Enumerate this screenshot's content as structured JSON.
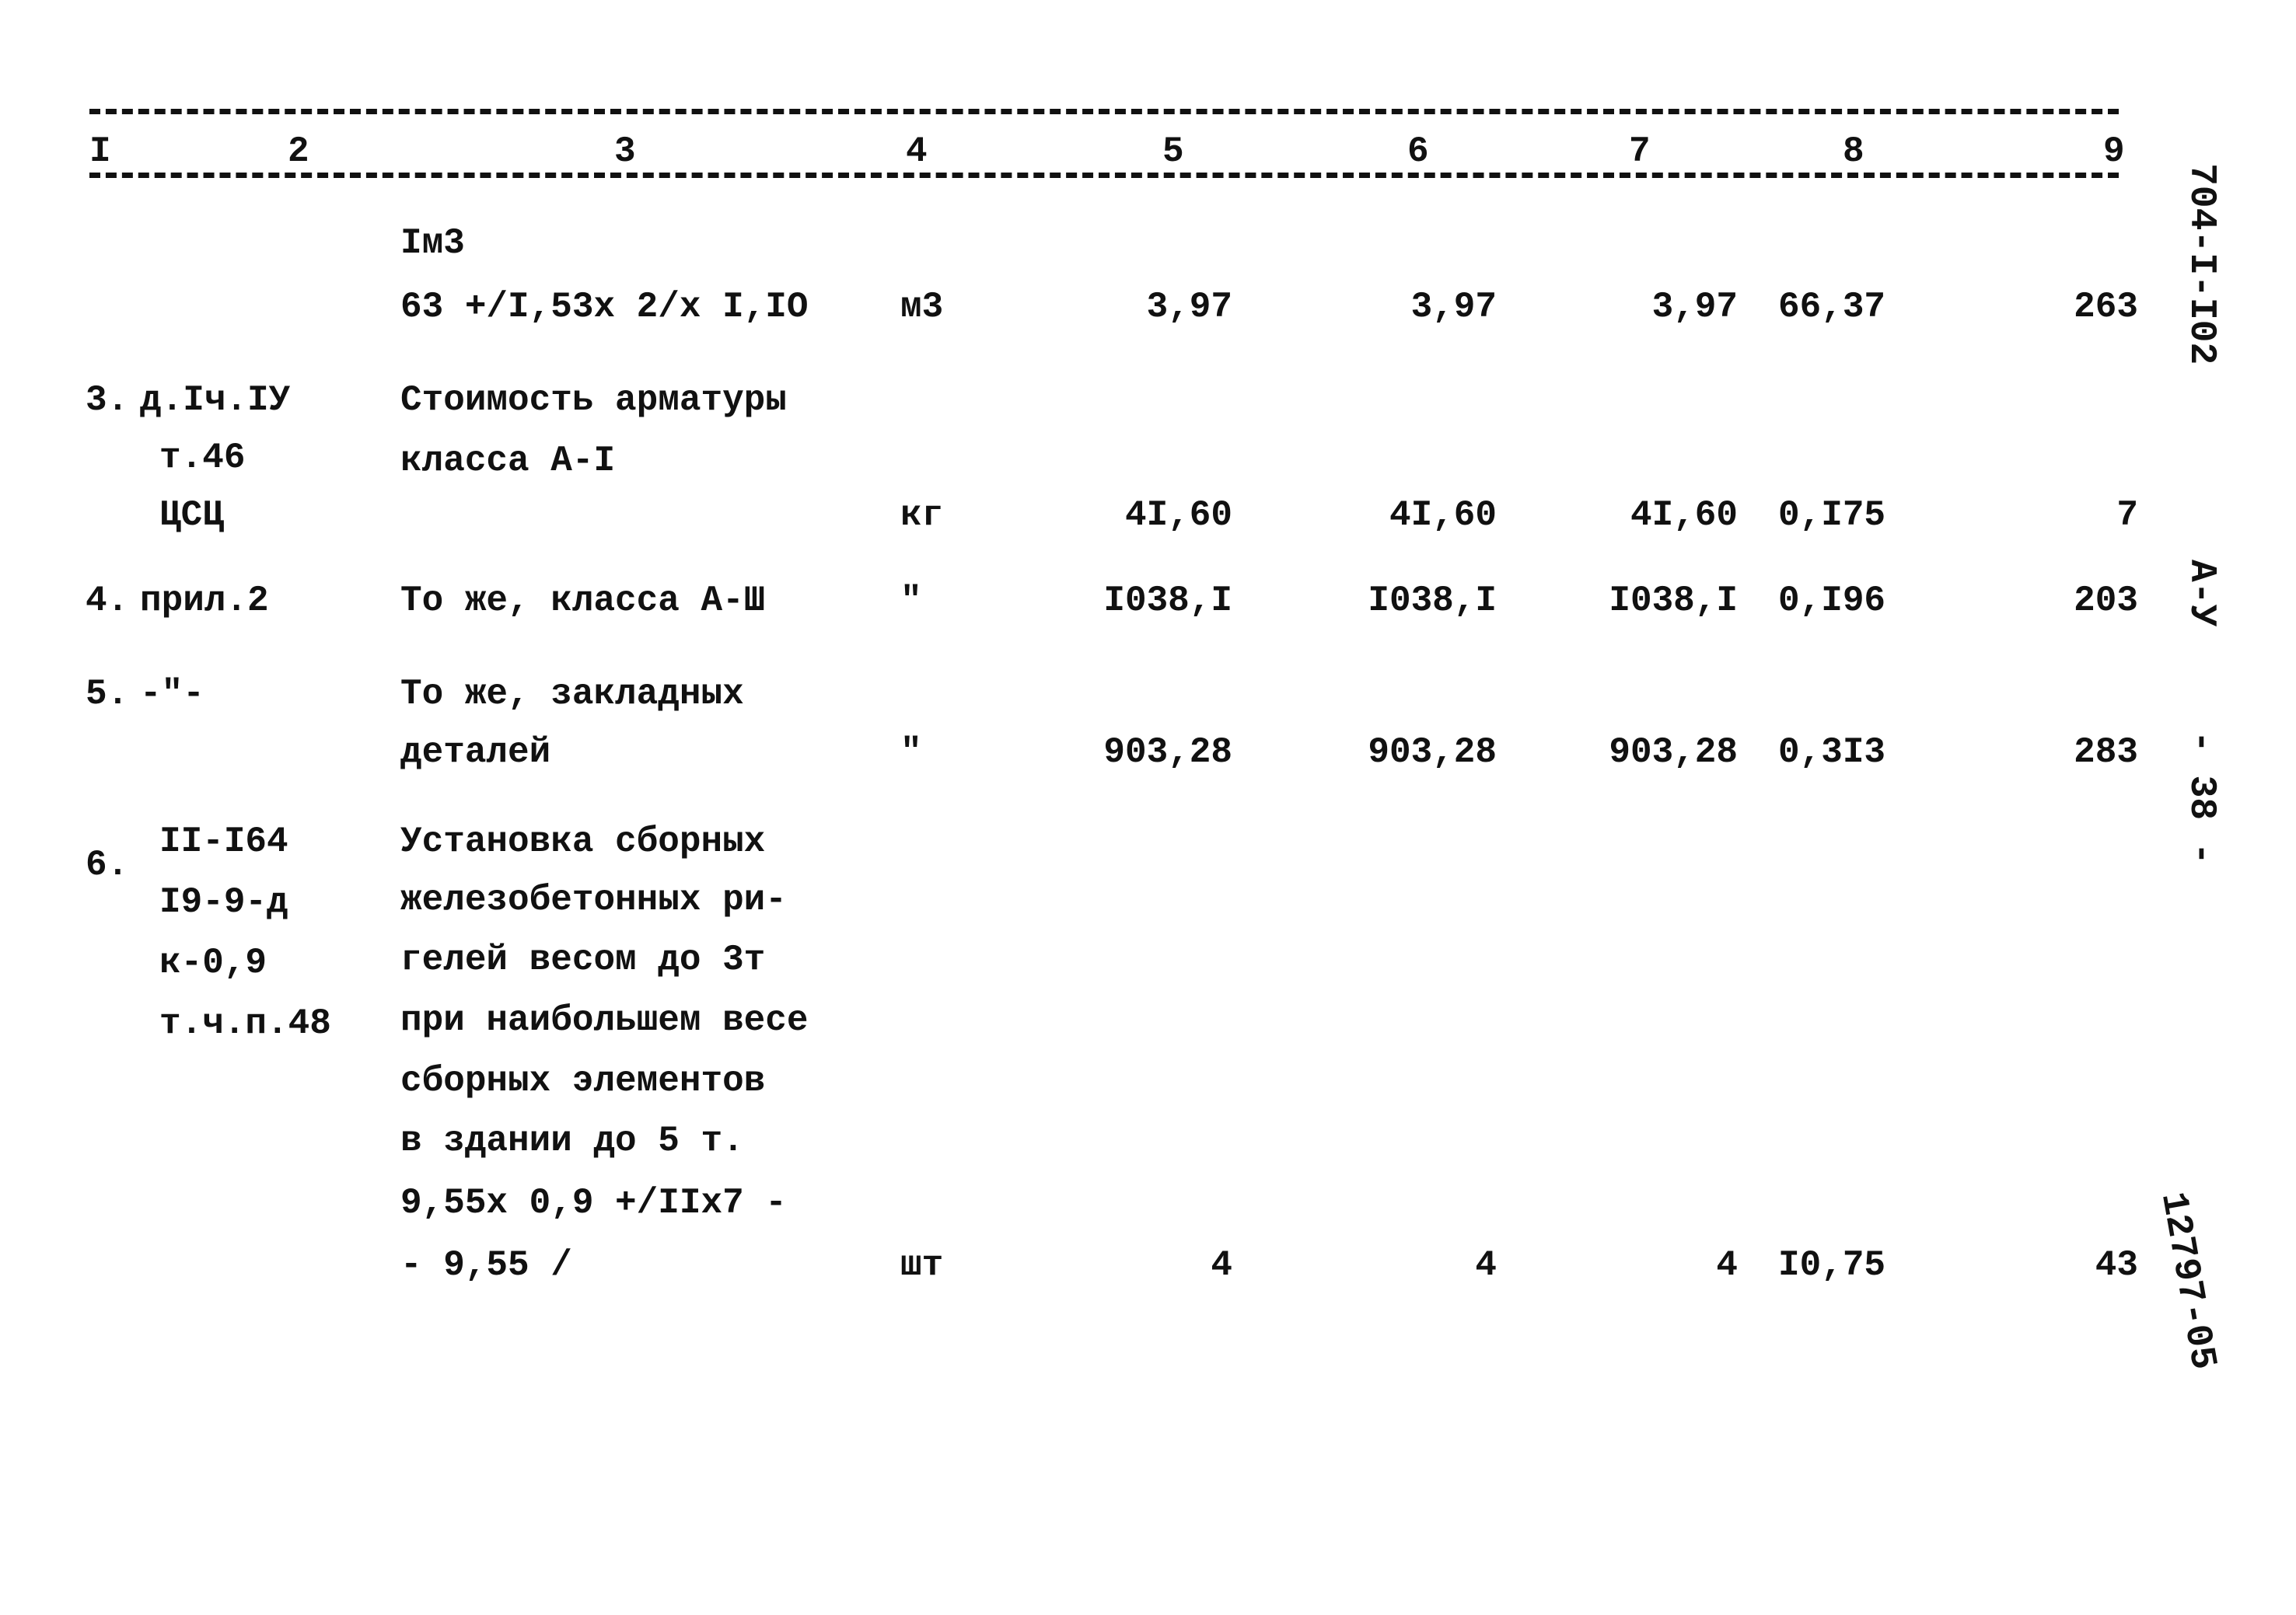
{
  "header_columns": [
    "I",
    "2",
    "3",
    "4",
    "5",
    "6",
    "7",
    "8",
    "9"
  ],
  "rows": [
    {
      "ref": [],
      "num": "",
      "desc": [
        "Iм3",
        "63 +/I,53x 2/x I,IO"
      ],
      "unit": "м3",
      "c5": "3,97",
      "c6": "3,97",
      "c7": "3,97",
      "c8": "66,37",
      "c9": "263"
    },
    {
      "num": "3.",
      "ref": [
        "д.Iч.IУ",
        "т.46",
        "ЦСЦ"
      ],
      "desc": [
        "Стоимость арматуры",
        "класса А-I"
      ],
      "unit": "кг",
      "c5": "4I,60",
      "c6": "4I,60",
      "c7": "4I,60",
      "c8": "0,I75",
      "c9": "7"
    },
    {
      "num": "4.",
      "ref": [
        "прил.2"
      ],
      "desc": [
        "То же, класса А-Ш"
      ],
      "unit": "\"",
      "c5": "I038,I",
      "c6": "I038,I",
      "c7": "I038,I",
      "c8": "0,I96",
      "c9": "203"
    },
    {
      "num": "5.",
      "ref": [
        "-\"-"
      ],
      "desc": [
        "То же, закладных",
        "деталей"
      ],
      "unit": "\"",
      "c5": "903,28",
      "c6": "903,28",
      "c7": "903,28",
      "c8": "0,3I3",
      "c9": "283"
    },
    {
      "num": "6.",
      "ref": [
        "II-I64",
        "I9-9-д",
        "к-0,9",
        "т.ч.п.48"
      ],
      "desc": [
        "Установка сборных",
        "железобетонных ри-",
        "гелей весом до 3т",
        "при наибольшем весе",
        "сборных элементов",
        "в здании до 5 т.",
        "9,55x 0,9 +/IIx7 -",
        "- 9,55 /"
      ],
      "unit": "шт",
      "c5": "4",
      "c6": "4",
      "c7": "4",
      "c8": "I0,75",
      "c9": "43"
    }
  ],
  "margin": {
    "code": "704-I-I02",
    "album": "А-У",
    "page": "- 38 -",
    "stamp": "12797-05"
  }
}
